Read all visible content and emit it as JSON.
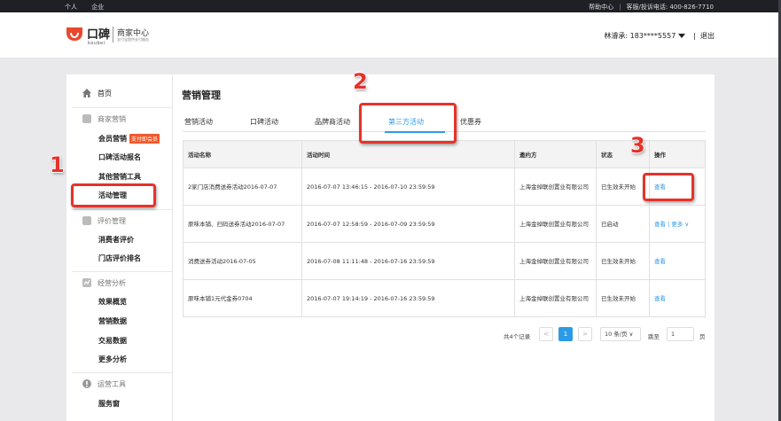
{
  "topbar": {
    "left": [
      "个人",
      "企业"
    ],
    "help": "帮助中心",
    "hotline": "客服/投诉电话: 400-826-7710"
  },
  "header": {
    "logo_brand": "口碑",
    "logo_sub": "koubei",
    "logo_center": "商家中心",
    "logo_center_sub": "支付宝提供支付服务",
    "user": "林濬承: 183****5557",
    "logout": "退出"
  },
  "sidebar": {
    "home": "首页",
    "groups": [
      {
        "title": "商家营销",
        "items": [
          "会员营销",
          "口碑活动报名",
          "其他营销工具",
          "活动管理"
        ],
        "tag": "支付即会员"
      },
      {
        "title": "评价管理",
        "items": [
          "消费者评价",
          "门店评价排名"
        ]
      },
      {
        "title": "经营分析",
        "items": [
          "效果概览",
          "营销数据",
          "交易数据",
          "更多分析"
        ]
      },
      {
        "title": "运营工具",
        "items": [
          "服务窗"
        ]
      }
    ]
  },
  "main": {
    "title": "营销管理",
    "tabs": [
      "营销活动",
      "口碑活动",
      "品牌商活动",
      "第三方活动",
      "优惠券"
    ],
    "active_tab": "第三方活动",
    "columns": [
      "活动名称",
      "活动时间",
      "邀约方",
      "状态",
      "操作"
    ],
    "rows": [
      {
        "name": "2家门店消费送券活动2016-07-07",
        "time": "2016-07-07 13:46:15 - 2016-07-10 23:59:59",
        "inviter": "上海金绰联创置业有限公司",
        "status": "已生效未开始",
        "action": "查看",
        "more": ""
      },
      {
        "name": "原味本铺、扫码送券活动2016-07-07",
        "time": "2016-07-07 12:58:59 - 2016-07-09 23:59:59",
        "inviter": "上海金绰联创置业有限公司",
        "status": "已启动",
        "action": "查看",
        "more": "| 更多 ∨"
      },
      {
        "name": "消费送券活动2016-07-05",
        "time": "2016-07-08 11:11:48 - 2016-07-16 23:59:59",
        "inviter": "上海金绰联创置业有限公司",
        "status": "已生效未开始",
        "action": "查看",
        "more": ""
      },
      {
        "name": "原味本铺1元代金券0704",
        "time": "2016-07-07 19:14:19 - 2016-07-16 23:59:59",
        "inviter": "上海金绰联创置业有限公司",
        "status": "已生效未开始",
        "action": "查看",
        "more": ""
      }
    ],
    "pager": {
      "total": "共4个记录",
      "prev": "<",
      "current": "1",
      "next": ">",
      "size": "10 条/页 ∨",
      "jump": "跳至",
      "jump_value": "1",
      "unit": "页"
    }
  },
  "annotations": [
    "1",
    "2",
    "3"
  ],
  "colors": {
    "accent": "#2d9ae8",
    "highlight": "#e5332a",
    "tag": "#f2592a",
    "topbar": "#1f1f26"
  }
}
